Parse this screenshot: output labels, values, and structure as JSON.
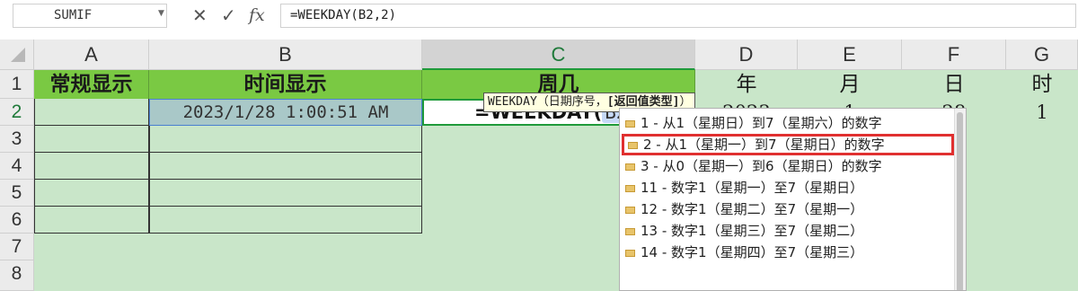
{
  "formula_bar": {
    "name_box": "SUMIF",
    "cancel_icon": "✕",
    "confirm_icon": "✓",
    "fx_icon": "fx",
    "formula": "=WEEKDAY(B2,2)"
  },
  "columns": [
    "A",
    "B",
    "C",
    "D",
    "E",
    "F",
    "G"
  ],
  "rows": [
    "1",
    "2",
    "3",
    "4",
    "5",
    "6",
    "7",
    "8"
  ],
  "header_row": {
    "A": "常规显示",
    "B": "时间显示",
    "C": "周几",
    "D": "年",
    "E": "月",
    "F": "日",
    "G": "时"
  },
  "row2": {
    "A": "",
    "B": "2023/1/28 1:00:51 AM",
    "C_prefix": "=WEEKDAY(",
    "C_ref": "B2",
    "C_suffix": ",2",
    "C_close": ")",
    "D": "2023",
    "E": "1",
    "F": "28",
    "G": "1"
  },
  "tooltip": {
    "text": "WEEKDAY（日期序号，",
    "bold": "[返回值类型]",
    "close": "）"
  },
  "dropdown": {
    "items": [
      "1 - 从1（星期日）到7（星期六）的数字",
      "2 - 从1（星期一）到7（星期日）的数字",
      "3 - 从0（星期一）到6（星期日）的数字",
      "11 - 数字1（星期一）至7（星期日）",
      "12 - 数字1（星期二）至7（星期一）",
      "13 - 数字1（星期三）至7（星期二）",
      "14 - 数字1（星期四）至7（星期三）"
    ],
    "selected_index": 1
  },
  "colors": {
    "header_fill": "#7ac943",
    "sheet_fill": "#c9e6c9",
    "selection_border": "#e03030",
    "active_cell_border": "#1f9a3a"
  }
}
